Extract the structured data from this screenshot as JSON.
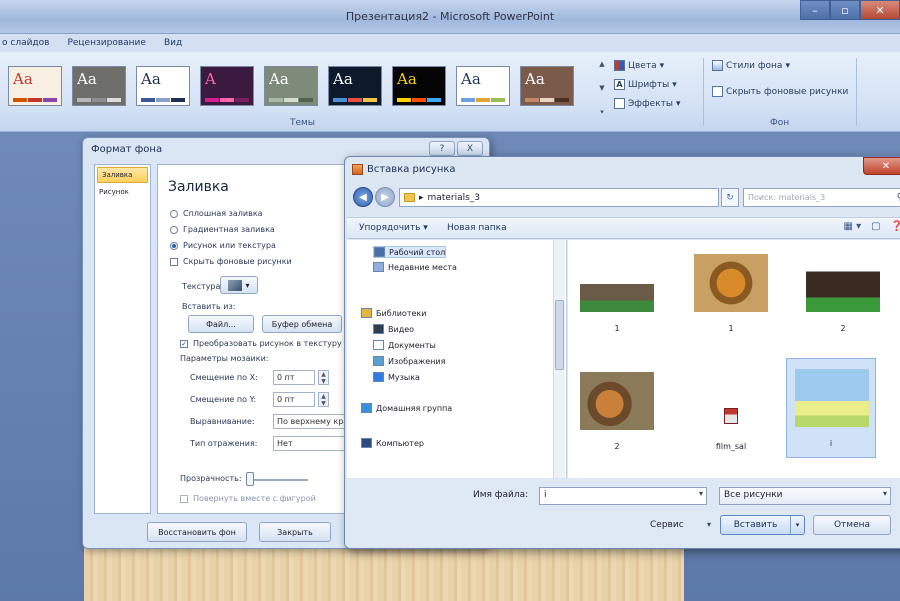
{
  "app": {
    "window_title": "Презентация2 - Microsoft PowerPoint",
    "window_buttons": {
      "minimize": "–",
      "maximize": "▫",
      "close": "✕"
    }
  },
  "ribbon": {
    "tabs": [
      "о слайдов",
      "Рецензирование",
      "Вид"
    ],
    "themes": [
      {
        "label": "Aa",
        "bg": "#f7efe2",
        "fg": "#c0392b",
        "colors": [
          "#d35400",
          "#c0392b",
          "#8e44ad"
        ]
      },
      {
        "label": "Aa",
        "bg": "#6e6f6b",
        "fg": "#ffffff",
        "colors": [
          "#b7b7b7",
          "#8f8f8f",
          "#dcdcdc"
        ]
      },
      {
        "label": "Aa",
        "bg": "#ffffff",
        "fg": "#1f2f4f",
        "colors": [
          "#3b5998",
          "#8aa0c8",
          "#1f2f4f"
        ]
      },
      {
        "label": "A",
        "bg": "#3a1a3e",
        "fg": "#ff66aa",
        "colors": [
          "#d61f8f",
          "#ff66aa",
          "#7a1f5e"
        ]
      },
      {
        "label": "Aa",
        "bg": "#7e8a7a",
        "fg": "#ffffff",
        "colors": [
          "#a9b9a5",
          "#d5dcd2",
          "#536150"
        ]
      },
      {
        "label": "Aa",
        "bg": "#0c1a2c",
        "fg": "#ffffff",
        "colors": [
          "#4a90d9",
          "#e94e3c",
          "#f5c542"
        ]
      },
      {
        "label": "Aa",
        "bg": "#050505",
        "fg": "#ffd200",
        "colors": [
          "#ffd200",
          "#ff4d00",
          "#3fa9f5"
        ]
      },
      {
        "label": "Aa",
        "bg": "#ffffff",
        "fg": "#1a3a66",
        "colors": [
          "#6d9ee6",
          "#e1a531",
          "#9bbb59"
        ]
      },
      {
        "label": "Aa",
        "bg": "#7b5a4a",
        "fg": "#ffffff",
        "colors": [
          "#c08a6a",
          "#e6d3c2",
          "#4a3024"
        ]
      }
    ],
    "small_commands": {
      "colors": "Цвета",
      "fonts": "Шрифты",
      "effects": "Эффекты",
      "bg_styles": "Стили фона",
      "hide_bg": "Скрыть фоновые рисунки"
    },
    "group_labels": {
      "themes": "Темы",
      "background": "Фон"
    }
  },
  "format_dialog": {
    "title": "Формат фона",
    "title_buttons": [
      "?",
      "X"
    ],
    "nav": [
      "Заливка",
      "Рисунок"
    ],
    "heading": "Заливка",
    "fill_options": [
      "Сплошная заливка",
      "Градиентная заливка",
      "Рисунок или текстура"
    ],
    "hide_bg_checkbox": "Скрыть фоновые рисунки",
    "texture_label": "Текстура:",
    "insert_from_label": "Вставить из:",
    "file_button": "Файл...",
    "clipboard_button": "Буфер обмена",
    "tile_checkbox": "Преобразовать рисунок в текстуру",
    "tiling_params_label": "Параметры мозаики:",
    "offset_x_label": "Смещение по X:",
    "offset_x_value": "0 пт",
    "offset_y_label": "Смещение по Y:",
    "offset_y_value": "0 пт",
    "align_label": "Выравнивание:",
    "align_value": "По верхнему краю",
    "mirror_label": "Тип отражения:",
    "mirror_value": "Нет",
    "transparency_label": "Прозрачность:",
    "rotate_checkbox": "Повернуть вместе с фигурой",
    "reset_button": "Восстановить фон",
    "close_button": "Закрыть"
  },
  "insert_dialog": {
    "title": "Вставка рисунка",
    "address": "materials_3",
    "search_placeholder": "Поиск: materials_3",
    "toolbar": {
      "organize": "Упорядочить ▾",
      "new_folder": "Новая папка"
    },
    "tree": [
      {
        "label": "Рабочий стол",
        "icon": "#4a6fa8"
      },
      {
        "label": "Недавние места",
        "icon": "#8fb0d8"
      },
      {
        "label": "Библиотеки",
        "icon": "#e3b542"
      },
      {
        "label": "Видео",
        "icon": "#2c3e50"
      },
      {
        "label": "Документы",
        "icon": "#ffffff"
      },
      {
        "label": "Изображения",
        "icon": "#5aa0d0"
      },
      {
        "label": "Музыка",
        "icon": "#2f7de0"
      },
      {
        "label": "Домашняя группа",
        "icon": "#3a8ee0"
      },
      {
        "label": "Компьютер",
        "icon": "#2c4a7a"
      }
    ],
    "files": [
      {
        "caption": "1",
        "kind": "elephant"
      },
      {
        "caption": "1",
        "kind": "tiger"
      },
      {
        "caption": "2",
        "kind": "boar"
      },
      {
        "caption": "2",
        "kind": "tigers"
      },
      {
        "caption": "film_sal",
        "kind": "file"
      },
      {
        "caption": "i",
        "kind": "meadow"
      }
    ],
    "filename_label": "Имя файла:",
    "filename_value": "i",
    "filetype_value": "Все рисунки",
    "service_label": "Сервис",
    "insert_button": "Вставить",
    "cancel_button": "Отмена"
  }
}
